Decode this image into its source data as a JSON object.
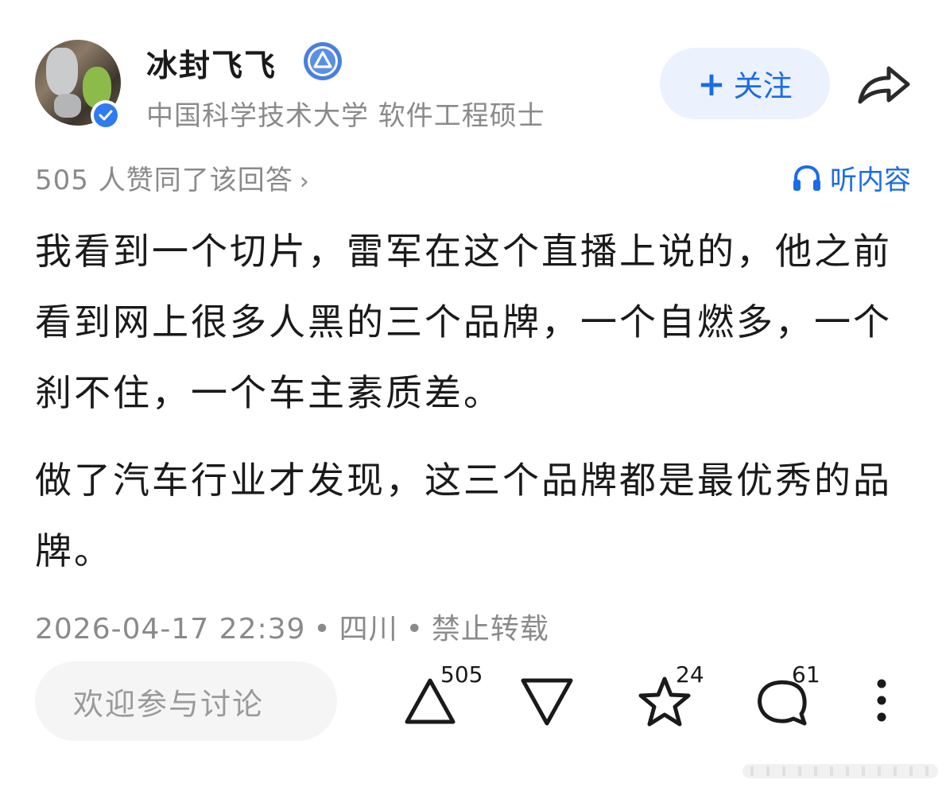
{
  "author": {
    "name": "冰封飞飞",
    "description": "中国科学技术大学 软件工程硕士"
  },
  "follow_button": {
    "label": "关注"
  },
  "votes_summary": {
    "text": "505 人赞同了该回答",
    "chevron": "›"
  },
  "listen_button": {
    "label": "听内容"
  },
  "answer": {
    "paragraph_1": "我看到一个切片，雷军在这个直播上说的，他之前看到网上很多人黑的三个品牌，一个自燃多，一个刹不住，一个车主素质差。",
    "paragraph_2": "做了汽车行业才发现，这三个品牌都是最优秀的品牌。"
  },
  "meta": {
    "timestamp": "2026-04-17 22:39",
    "location": "四川",
    "copyright": "禁止转载",
    "separator": "•"
  },
  "discuss_input": {
    "placeholder": "欢迎参与讨论"
  },
  "actions": {
    "upvote_count": "505",
    "favorite_count": "24",
    "comment_count": "61"
  },
  "colors": {
    "accent": "#1a6ce8",
    "follow_bg": "#ebf2fd",
    "muted_text": "#8a8a8a"
  }
}
